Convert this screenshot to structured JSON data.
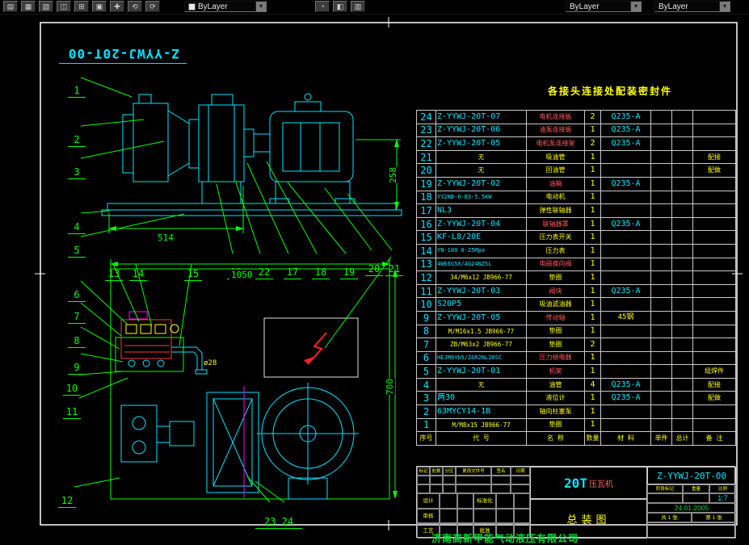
{
  "toolbar": {
    "color_combo": "ByLayer",
    "linetype_combo": "ByLayer",
    "lineweight_combo": "ByLayer",
    "button_glyphs": [
      "▤",
      "▦",
      "▧",
      "◫",
      "⊞",
      "▣",
      "✚",
      "⟲",
      "⟳"
    ],
    "mid_glyphs": [
      "◔",
      "◧",
      "▥"
    ],
    "chevron": "▾"
  },
  "drawing": {
    "stamp": "Z-YYWJ-20T-00",
    "seal_note": "各接头连接处配装密封件",
    "dims": {
      "base_width": "514",
      "motor_height": "258",
      "tank_length": "1050",
      "tank_width": "700",
      "pipe_dia": "ø28"
    },
    "leaders": [
      "1",
      "2",
      "3",
      "4",
      "5",
      "6",
      "7",
      "8",
      "9",
      "10",
      "11",
      "12",
      "13",
      "14",
      "15",
      "16",
      "22",
      "17",
      "18",
      "19",
      "20",
      "21",
      "23 24"
    ]
  },
  "parts_table": {
    "header": [
      "序号",
      "代  号",
      "名  称",
      "数量",
      "材  料",
      "单件",
      "总计",
      "备  注"
    ],
    "rows": [
      {
        "no": "24",
        "code": "Z-YYWJ-20T-07",
        "name": "电机连接板",
        "qty": "2",
        "mat": "Q235-A",
        "rem": "",
        "cc": "c",
        "nc": "r"
      },
      {
        "no": "23",
        "code": "Z-YYWJ-20T-06",
        "name": "油泵连接板",
        "qty": "1",
        "mat": "Q235-A",
        "rem": "",
        "cc": "c",
        "nc": "r"
      },
      {
        "no": "22",
        "code": "Z-YYWJ-20T-05",
        "name": "电机泵连接架",
        "qty": "2",
        "mat": "Q235-A",
        "rem": "",
        "cc": "c",
        "nc": "r"
      },
      {
        "no": "21",
        "code": "无",
        "name": "吸油管",
        "qty": "1",
        "mat": "",
        "rem": "配接",
        "cc": "y",
        "nc": "y"
      },
      {
        "no": "20",
        "code": "无",
        "name": "回油管",
        "qty": "1",
        "mat": "",
        "rem": "配做",
        "cc": "y",
        "nc": "y"
      },
      {
        "no": "19",
        "code": "Z-YYWJ-20T-02",
        "name": "油箱",
        "qty": "1",
        "mat": "Q235-A",
        "rem": "",
        "cc": "c",
        "nc": "r"
      },
      {
        "no": "18",
        "code": "YY2NB-6-B3-5.5KW",
        "name": "电动机",
        "qty": "1",
        "mat": "",
        "rem": "",
        "cc": "cs",
        "nc": "y"
      },
      {
        "no": "17",
        "code": "NL3",
        "name": "弹性联轴器",
        "qty": "1",
        "mat": "",
        "rem": "",
        "cc": "c",
        "nc": "y"
      },
      {
        "no": "16",
        "code": "Z-YYWJ-20T-04",
        "name": "联轴器罩",
        "qty": "1",
        "mat": "Q235-A",
        "rem": "",
        "cc": "c",
        "nc": "r"
      },
      {
        "no": "15",
        "code": "KF-L8/20E",
        "name": "压力表开关",
        "qty": "1",
        "mat": "",
        "rem": "",
        "cc": "c",
        "nc": "y"
      },
      {
        "no": "14",
        "code": "YN-100 0-25Mpa",
        "name": "压力表",
        "qty": "1",
        "mat": "",
        "rem": "",
        "cc": "cs",
        "nc": "y"
      },
      {
        "no": "13",
        "code": "4WE6G5X/AG24NZ5L",
        "name": "电磁换向阀",
        "qty": "1",
        "mat": "",
        "rem": "",
        "cc": "cs",
        "nc": "r"
      },
      {
        "no": "12",
        "code": "34/M6x12 JB966-77",
        "name": "垫圈",
        "qty": "1",
        "mat": "",
        "rem": "",
        "cc": "y",
        "nc": "y"
      },
      {
        "no": "11",
        "code": "Z-YYWJ-20T-03",
        "name": "阀块",
        "qty": "1",
        "mat": "Q235-A",
        "rem": "",
        "cc": "c",
        "nc": "r"
      },
      {
        "no": "10",
        "code": "S20P5",
        "name": "吸油滤油器",
        "qty": "1",
        "mat": "",
        "rem": "",
        "cc": "c",
        "nc": "y"
      },
      {
        "no": "9",
        "code": "Z-YYWJ-20T-05",
        "name": "传动轴",
        "qty": "1",
        "mat": "45钢",
        "rem": "",
        "cc": "c",
        "nc": "r",
        "mc": "y"
      },
      {
        "no": "8",
        "code": "M/M16x1.5 JB966-77",
        "name": "垫圈",
        "qty": "1",
        "mat": "",
        "rem": "",
        "cc": "y",
        "nc": "y"
      },
      {
        "no": "7",
        "code": "ZB/M63x2 JB966-77",
        "name": "垫圈",
        "qty": "2",
        "mat": "",
        "rem": "",
        "cc": "y",
        "nc": "y"
      },
      {
        "no": "6",
        "code": "HEJM9Yb5/Z6R2NL20SC",
        "name": "压力继电器",
        "qty": "1",
        "mat": "",
        "rem": "",
        "cc": "cs",
        "nc": "r"
      },
      {
        "no": "5",
        "code": "Z-YYWJ-20T-01",
        "name": "机架",
        "qty": "1",
        "mat": "",
        "rem": "组焊件",
        "cc": "c",
        "nc": "r"
      },
      {
        "no": "4",
        "code": "无",
        "name": "油管",
        "qty": "4",
        "mat": "Q235-A",
        "rem": "配接",
        "cc": "y",
        "nc": "y"
      },
      {
        "no": "3",
        "code": "两30",
        "name": "液位计",
        "qty": "1",
        "mat": "Q235-A",
        "rem": "配做",
        "cc": "c",
        "nc": "y"
      },
      {
        "no": "2",
        "code": "63MYCY14-1B",
        "name": "轴向柱塞泵",
        "qty": "1",
        "mat": "",
        "rem": "",
        "cc": "c",
        "nc": "y"
      },
      {
        "no": "1",
        "code": "M/M8x15 JB966-77",
        "name": "垫圈",
        "qty": "1",
        "mat": "",
        "rem": "",
        "cc": "y",
        "nc": "y"
      }
    ]
  },
  "title_block": {
    "drawing_no": "Z-YYWJ-20T-00",
    "product_code": "20T",
    "product_name": "压瓦机",
    "sheet_name": "总装图",
    "company": "济南高新甲能气动液压有限公司",
    "scale_label": "比例",
    "scale": "1:7",
    "weight_label": "重量",
    "stage_label": "阶段标记",
    "date": "24.01.2005",
    "sheet_count": "共 1 张",
    "sheet_index": "第 1 张",
    "rev_headers": [
      "标记",
      "处数",
      "分区",
      "更改文件号",
      "签名",
      "日期"
    ],
    "sign_labels": [
      "设计",
      "审核",
      "工艺",
      "标准化",
      "批准"
    ]
  }
}
